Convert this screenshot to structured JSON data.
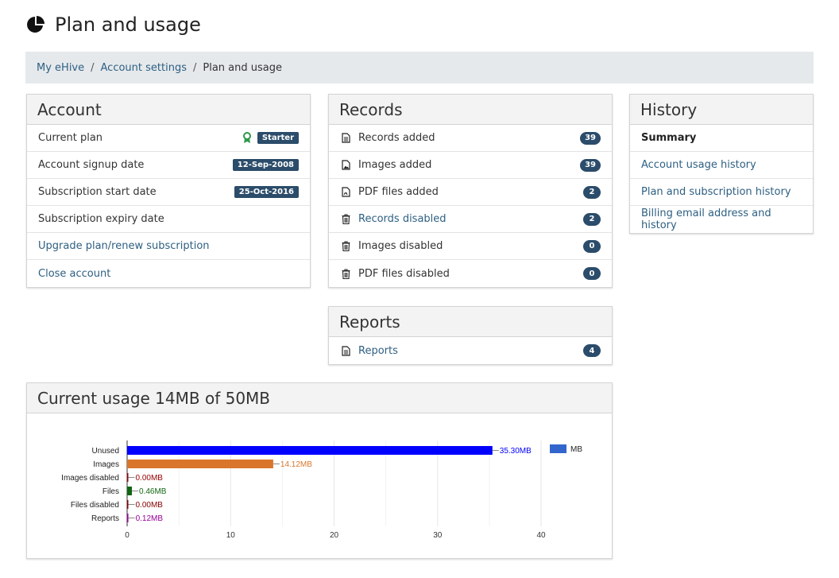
{
  "header": {
    "title": "Plan and usage",
    "icon": "pie-chart-icon"
  },
  "breadcrumb": {
    "items": [
      "My eHive",
      "Account settings",
      "Plan and usage"
    ]
  },
  "account": {
    "title": "Account",
    "current_plan_label": "Current plan",
    "current_plan_value": "Starter",
    "signup_label": "Account signup date",
    "signup_value": "12-Sep-2008",
    "sub_start_label": "Subscription start date",
    "sub_start_value": "25-Oct-2016",
    "sub_expiry_label": "Subscription expiry date",
    "upgrade_label": "Upgrade plan/renew subscription",
    "close_label": "Close account"
  },
  "records": {
    "title": "Records",
    "items": [
      {
        "label": "Records added",
        "count": "39",
        "icon": "document-icon"
      },
      {
        "label": "Images added",
        "count": "39",
        "icon": "image-file-icon"
      },
      {
        "label": "PDF files added",
        "count": "2",
        "icon": "pdf-file-icon"
      },
      {
        "label": "Records disabled",
        "count": "2",
        "icon": "trash-icon"
      },
      {
        "label": "Images disabled",
        "count": "0",
        "icon": "trash-icon"
      },
      {
        "label": "PDF files disabled",
        "count": "0",
        "icon": "trash-icon"
      }
    ]
  },
  "reports": {
    "title": "Reports",
    "item_label": "Reports",
    "item_count": "4"
  },
  "history": {
    "title": "History",
    "items": [
      "Summary",
      "Account usage history",
      "Plan and subscription history",
      "Billing email address and history"
    ]
  },
  "usage": {
    "title": "Current usage 14MB of 50MB"
  },
  "chart_data": {
    "type": "bar",
    "orientation": "horizontal",
    "categories": [
      "Unused",
      "Images",
      "Images disabled",
      "Files",
      "Files disabled",
      "Reports"
    ],
    "values": [
      35.3,
      14.12,
      0.0,
      0.46,
      0.0,
      0.12
    ],
    "data_labels": [
      "35.30MB",
      "14.12MB",
      "0.00MB",
      "0.46MB",
      "0.00MB",
      "0.12MB"
    ],
    "colors": [
      "#0000ff",
      "#d9762b",
      "#990000",
      "#116611",
      "#880000",
      "#990099"
    ],
    "xlim": [
      0,
      40
    ],
    "xticks": [
      "0",
      "10",
      "20",
      "30",
      "40"
    ],
    "legend": {
      "name": "MB",
      "color": "#3366cc",
      "position": "right"
    },
    "grid": true
  }
}
